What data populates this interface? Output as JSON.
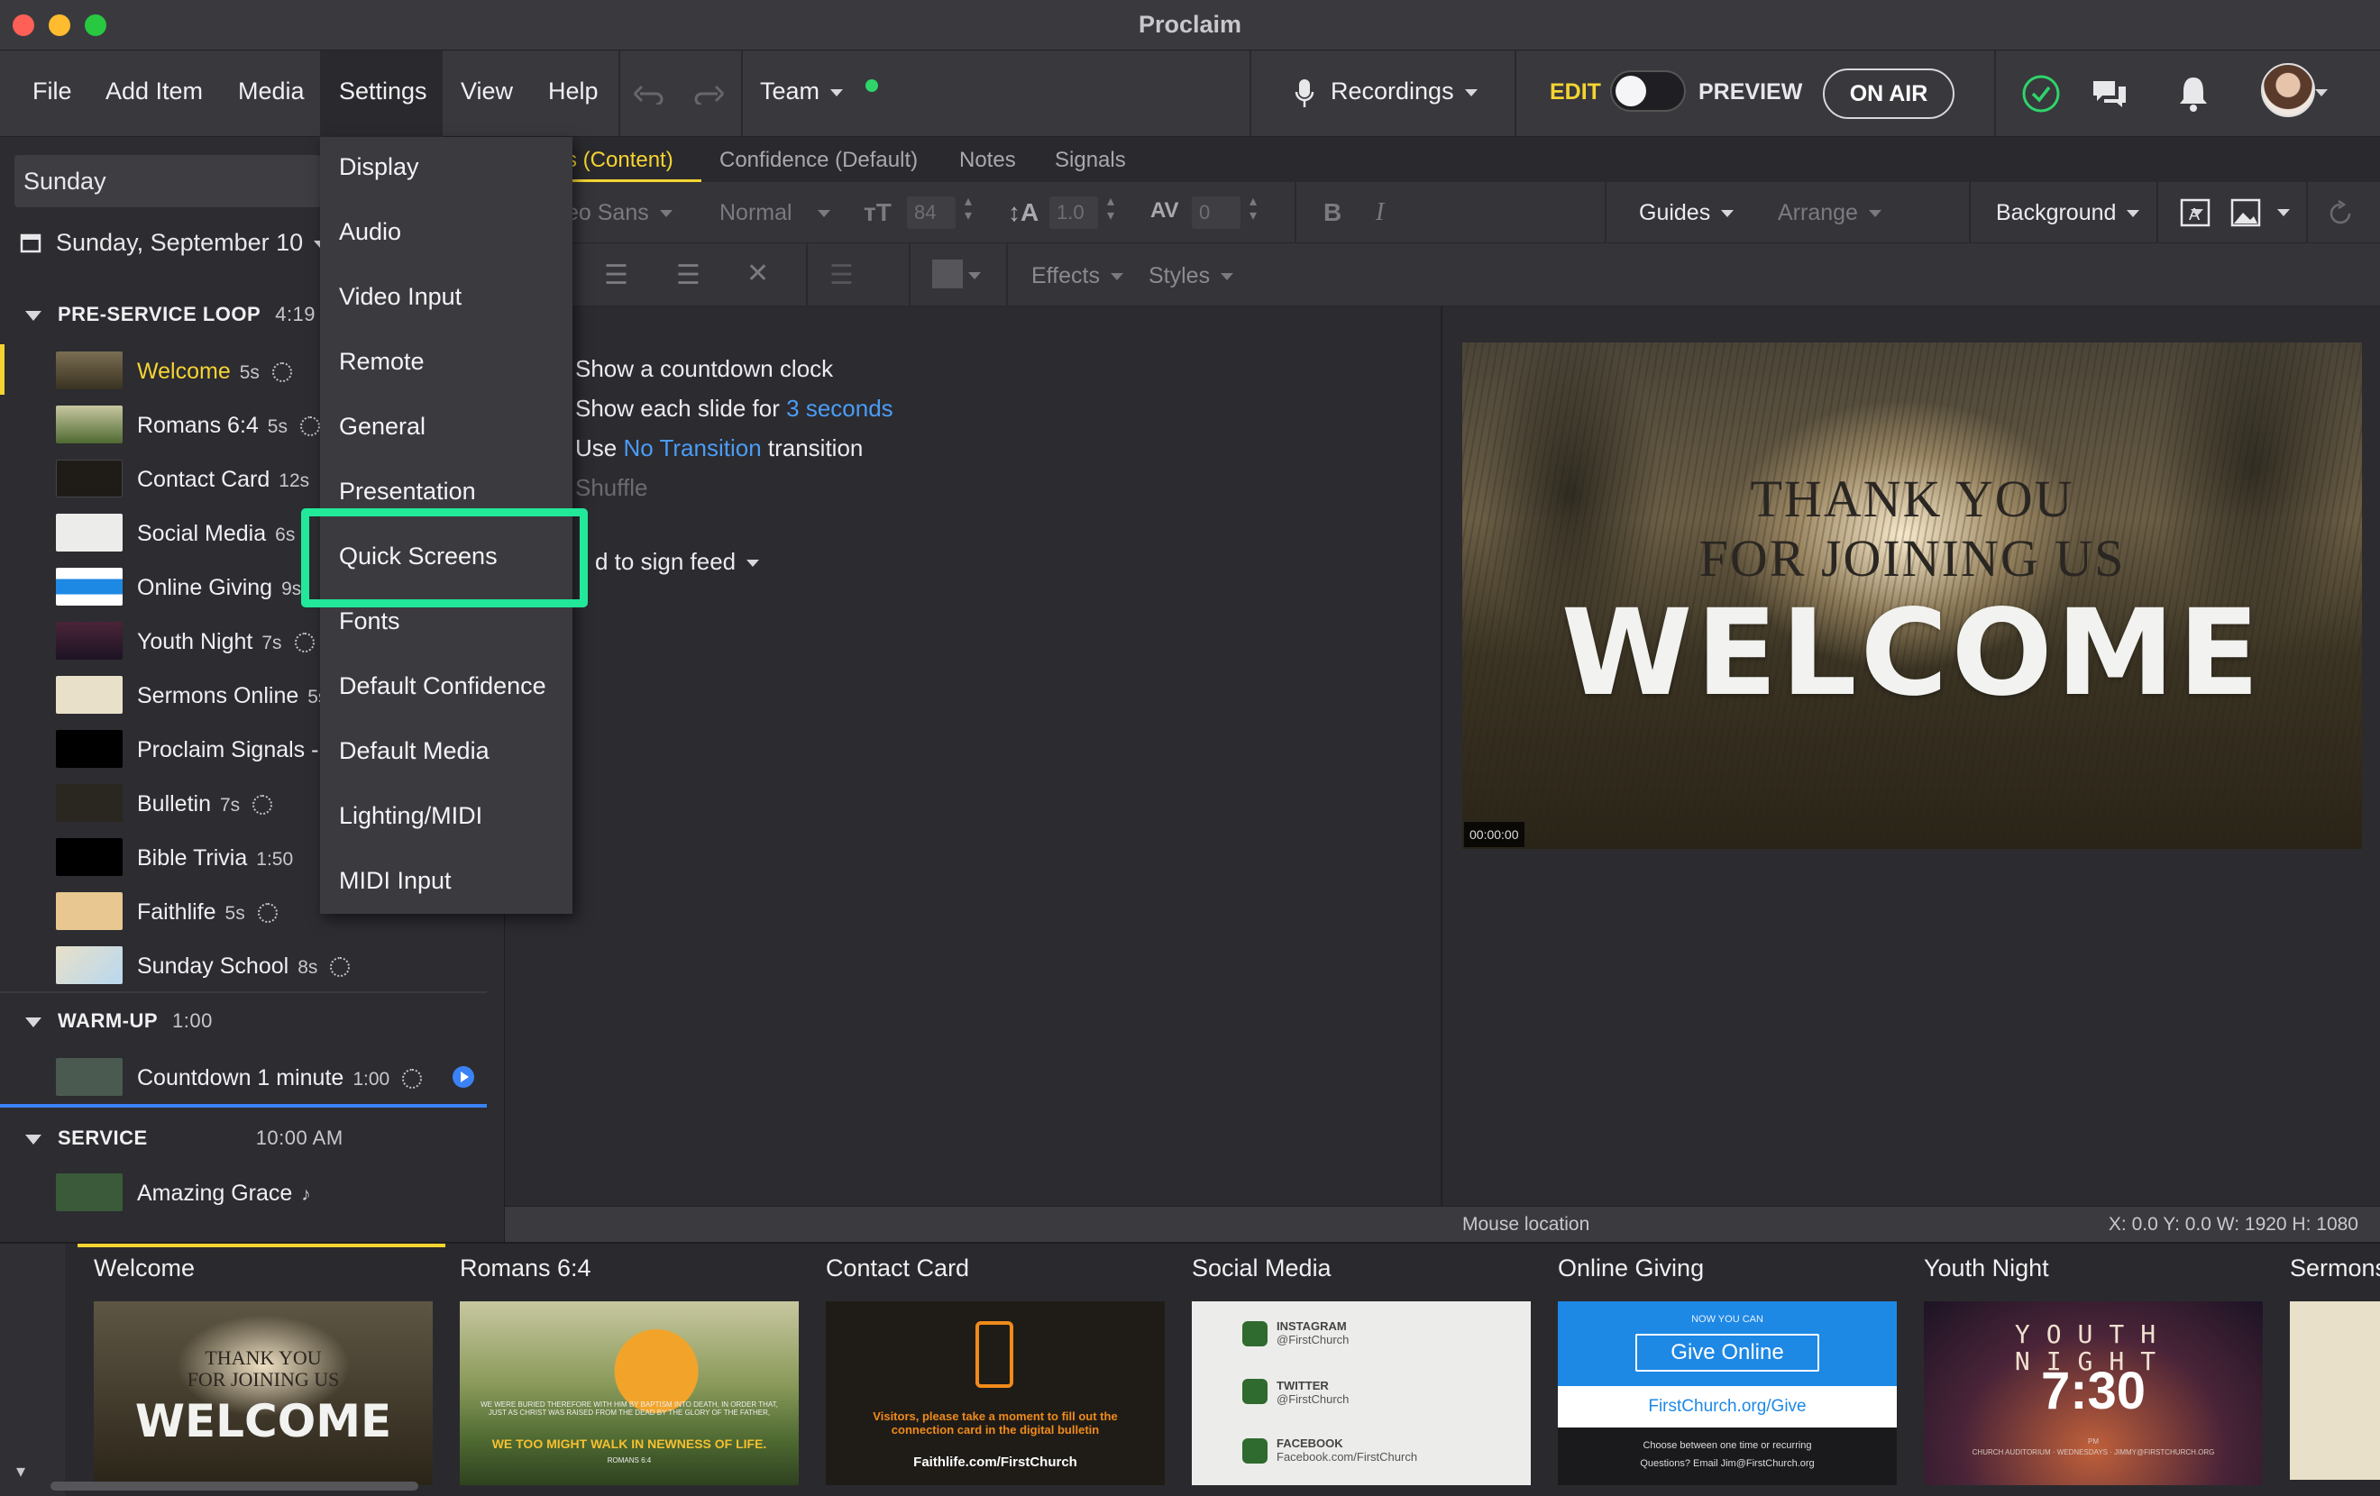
{
  "window": {
    "title": "Proclaim"
  },
  "menubar": {
    "items": [
      "File",
      "Add Item",
      "Media",
      "Settings",
      "View",
      "Help"
    ],
    "team_label": "Team",
    "recordings_label": "Recordings",
    "edit_label": "EDIT",
    "preview_label": "PREVIEW",
    "on_air_label": "ON AIR"
  },
  "settings_menu": {
    "items": [
      "Display",
      "Audio",
      "Video Input",
      "Remote",
      "General",
      "Presentation",
      "Quick Screens",
      "Fonts",
      "Default Confidence",
      "Default Media",
      "Lighting/MIDI",
      "MIDI Input"
    ],
    "highlighted": "Quick Screens"
  },
  "sidebar": {
    "service_name": "Sunday",
    "date": "Sunday, September 10",
    "sections": [
      {
        "title": "PRE-SERVICE LOOP",
        "duration": "4:19"
      },
      {
        "title": "WARM-UP",
        "duration": "1:00"
      },
      {
        "title": "SERVICE",
        "duration": "10:00 AM"
      }
    ],
    "preservice_items": [
      {
        "label": "Welcome",
        "duration": "5s"
      },
      {
        "label": "Romans 6:4",
        "duration": "5s"
      },
      {
        "label": "Contact Card",
        "duration": "12s"
      },
      {
        "label": "Social Media",
        "duration": "6s"
      },
      {
        "label": "Online Giving",
        "duration": "9s"
      },
      {
        "label": "Youth Night",
        "duration": "7s"
      },
      {
        "label": "Sermons Online",
        "duration": "5s"
      },
      {
        "label": "Proclaim Signals - (",
        "duration": ""
      },
      {
        "label": "Bulletin",
        "duration": "7s"
      },
      {
        "label": "Bible Trivia",
        "duration": "1:50"
      },
      {
        "label": "Faithlife",
        "duration": "5s"
      },
      {
        "label": "Sunday School",
        "duration": "8s"
      }
    ],
    "warmup_items": [
      {
        "label": "Countdown 1 minute",
        "duration": "1:00"
      }
    ],
    "service_items": [
      {
        "label": "Amazing Grace",
        "duration": "♪"
      }
    ]
  },
  "tabs": [
    "s (Content)",
    "Confidence (Default)",
    "Notes",
    "Signals"
  ],
  "format_bar": {
    "font": "eo Sans",
    "weight": "Normal",
    "size": "84",
    "line_height": "1.0",
    "spacing": "0",
    "guides": "Guides",
    "arrange": "Arrange",
    "background": "Background",
    "effects": "Effects",
    "styles": "Styles"
  },
  "editor": {
    "opt1": "Show a  countdown clock",
    "opt2_prefix": "Show each slide for ",
    "opt2_link": "3 seconds",
    "opt3_prefix": "Use ",
    "opt3_link": "No Transition",
    "opt3_suffix": " transition",
    "opt4": "Shuffle",
    "feed": "d to sign feed"
  },
  "preview_slide": {
    "line1": "THANK YOU",
    "line2": "FOR JOINING US",
    "line3": "WELCOME",
    "timecode": "00:00:00"
  },
  "statusbar": {
    "mouse_location": "Mouse location",
    "coords": "X: 0.0  Y: 0.0     W: 1920  H: 1080"
  },
  "filmstrip": {
    "cards": [
      "Welcome",
      "Romans 6:4",
      "Contact Card",
      "Social Media",
      "Online Giving",
      "Youth Night",
      "Sermons"
    ],
    "welcome": {
      "t1": "THANK YOU",
      "t2": "FOR JOINING US",
      "t3": "WELCOME"
    },
    "romans": {
      "body": "WE WERE BURIED THEREFORE WITH HIM BY BAPTISM INTO DEATH, IN ORDER THAT, JUST AS CHRIST WAS RAISED FROM THE DEAD BY THE GLORY OF THE FATHER,",
      "quote": "WE TOO MIGHT WALK IN NEWNESS OF LIFE.",
      "ref": "ROMANS 6:4"
    },
    "contact": {
      "text": "Visitors, please take a moment to fill out the connection card in the digital bulletin",
      "url": "Faithlife.com/FirstChurch"
    },
    "social": {
      "ig_title": "INSTAGRAM",
      "ig_handle": "@FirstChurch",
      "tw_title": "TWITTER",
      "tw_handle": "@FirstChurch",
      "fb_title": "FACEBOOK",
      "fb_handle": "Facebook.com/FirstChurch"
    },
    "giving": {
      "now": "NOW YOU CAN",
      "button": "Give Online",
      "url": "FirstChurch.org/Give",
      "note1": "Choose between one time or recurring",
      "note2": "Questions? Email Jim@FirstChurch.org"
    },
    "youth": {
      "l1": "YOUTH",
      "l2": "NIGHT",
      "time": "7:30",
      "pm": "PM",
      "info": "CHURCH AUDITORIUM · WEDNESDAYS · JIMMY@FIRSTCHURCH.ORG"
    }
  },
  "colors": {
    "accent_yellow": "#f5d432",
    "highlight_green": "#22e89a",
    "link_blue": "#4b9cf5"
  }
}
